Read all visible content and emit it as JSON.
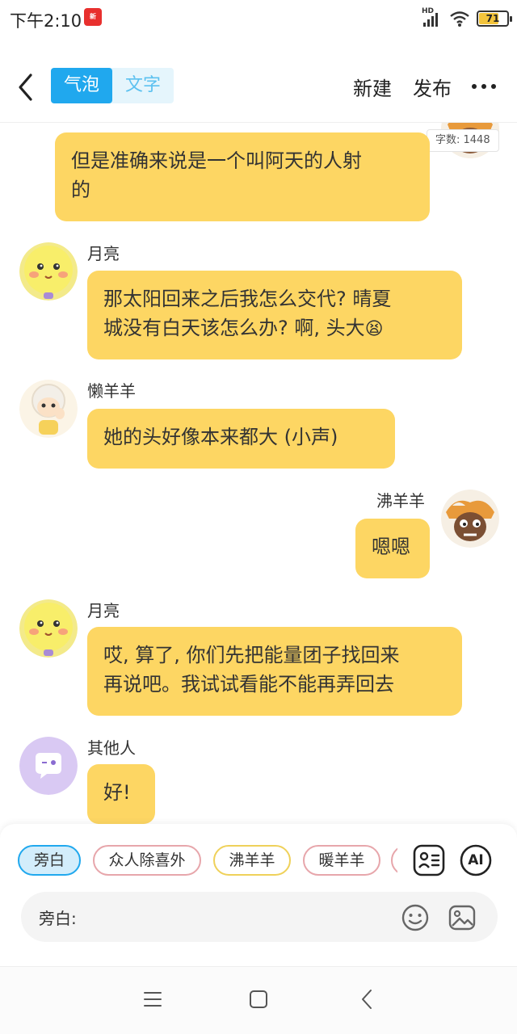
{
  "status_bar": {
    "time": "下午2:10",
    "app_icon_text": "新",
    "network_label": "HD",
    "battery": "71",
    "battery_level": 0.71
  },
  "header": {
    "tabs": [
      {
        "label": "气泡",
        "active": true
      },
      {
        "label": "文字",
        "active": false
      }
    ],
    "new_label": "新建",
    "publish_label": "发布"
  },
  "chat": {
    "word_count": "字数: 1448",
    "messages": [
      {
        "side": "right",
        "name": "",
        "text_lines": [
          "但是准确来说是一个叫阿天的人射",
          "的"
        ]
      },
      {
        "side": "left",
        "name": "月亮",
        "text_lines": [
          "那太阳回来之后我怎么交代? 晴夏",
          "城没有白天该怎么办? 啊, 头大"
        ],
        "emoji": "😫"
      },
      {
        "side": "left",
        "name": "懒羊羊",
        "text_lines": [
          "她的头好像本来都大 (小声)"
        ]
      },
      {
        "side": "right",
        "name": "沸羊羊",
        "text_lines": [
          "嗯嗯"
        ]
      },
      {
        "side": "left",
        "name": "月亮",
        "text_lines": [
          "哎, 算了, 你们先把能量团子找回来",
          "再说吧。我试试看能不能再弄回去"
        ]
      },
      {
        "side": "left",
        "name": "其他人",
        "text_lines": [
          "好!"
        ]
      }
    ]
  },
  "composer": {
    "chips": [
      {
        "label": "旁白",
        "selected": true
      },
      {
        "label": "众人除喜外",
        "selected": false
      },
      {
        "label": "沸羊羊",
        "selected": false
      },
      {
        "label": "暖羊羊",
        "selected": false
      }
    ],
    "ai_label": "AI",
    "input_label": "旁白:"
  },
  "colors": {
    "accent": "#20a8ee",
    "bubble": "#fdd663"
  }
}
